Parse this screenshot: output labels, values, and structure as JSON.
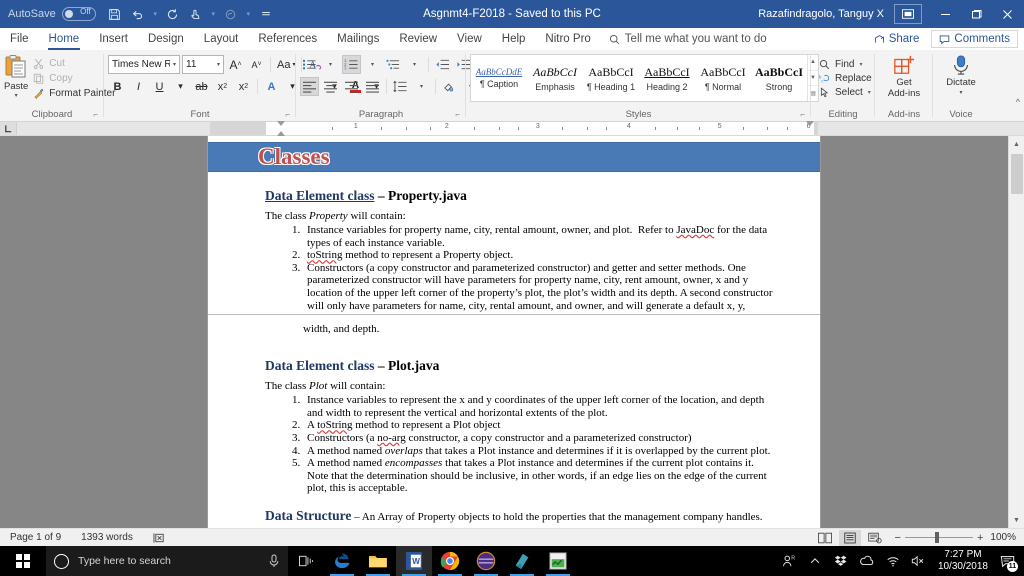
{
  "titlebar": {
    "autosave_label": "AutoSave",
    "autosave_state": "Off",
    "document_title": "Asgnmt4-F2018  -  Saved to this PC",
    "account_name": "Razafindragolo, Tanguy X",
    "qat": [
      {
        "name": "save-icon",
        "glyph": "💾"
      },
      {
        "name": "undo-icon",
        "glyph": "↶"
      },
      {
        "name": "redo-icon",
        "glyph": "↻"
      },
      {
        "name": "touch-mode-icon",
        "glyph": "☝"
      },
      {
        "name": "customize-qat-icon",
        "glyph": "☰"
      }
    ],
    "window_controls": {
      "ribbon_display": "⊟",
      "minimize": "─",
      "restore": "❐",
      "close": "✕"
    }
  },
  "tabs": [
    {
      "label": "File",
      "active": false
    },
    {
      "label": "Home",
      "active": true
    },
    {
      "label": "Insert",
      "active": false
    },
    {
      "label": "Design",
      "active": false
    },
    {
      "label": "Layout",
      "active": false
    },
    {
      "label": "References",
      "active": false
    },
    {
      "label": "Mailings",
      "active": false
    },
    {
      "label": "Review",
      "active": false
    },
    {
      "label": "View",
      "active": false
    },
    {
      "label": "Help",
      "active": false
    },
    {
      "label": "Nitro Pro",
      "active": false
    }
  ],
  "tellme": {
    "placeholder": "Tell me what you want to do"
  },
  "share": {
    "label": "Share"
  },
  "comments": {
    "label": "Comments"
  },
  "ribbon": {
    "clipboard": {
      "group_label": "Clipboard",
      "paste_label": "Paste",
      "cut_label": "Cut",
      "copy_label": "Copy",
      "format_painter_label": "Format Painter"
    },
    "font": {
      "group_label": "Font",
      "font_name": "Times New Ro",
      "font_size": "11",
      "grow_label": "A",
      "shrink_label": "A",
      "change_case_label": "Aa",
      "clear_format_label": "A",
      "bold_label": "B",
      "italic_label": "I",
      "underline_label": "U",
      "strike_label": "ab",
      "subscript_label": "x",
      "superscript_label": "x",
      "text_effects_label": "A",
      "highlight_label": "✎",
      "font_color_label": "A"
    },
    "paragraph": {
      "group_label": "Paragraph"
    },
    "styles": {
      "group_label": "Styles",
      "items": [
        {
          "preview": "AaBbCcDdE",
          "name": "¶ Caption"
        },
        {
          "preview": "AaBbCcI",
          "name": "Emphasis"
        },
        {
          "preview": "AaBbCcI",
          "name": "¶ Heading 1"
        },
        {
          "preview": "AaBbCcI",
          "name": "Heading 2"
        },
        {
          "preview": "AaBbCcI",
          "name": "¶ Normal"
        },
        {
          "preview": "AaBbCcI",
          "name": "Strong"
        }
      ]
    },
    "editing": {
      "group_label": "Editing",
      "find_label": "Find",
      "replace_label": "Replace",
      "select_label": "Select"
    },
    "addins": {
      "group_label": "Add-ins",
      "get_addins_label": "Get\nAdd-ins"
    },
    "voice": {
      "group_label": "Voice",
      "dictate_label": "Dictate"
    }
  },
  "ruler": {
    "ticks": [
      "1",
      "2",
      "3",
      "4",
      "5",
      "6"
    ]
  },
  "document": {
    "banner_title": "Classes",
    "sections": [
      {
        "heading_underlined": "Data Element class",
        "heading_dash": " – ",
        "heading_file": "Property.java",
        "intro_pre": "The class ",
        "intro_em": "Property",
        "intro_post": " will contain:",
        "items": [
          "Instance variables for property name, city, rental amount, owner, and plot.  Refer to JavaDoc for the data types of each instance variable.",
          "toString method to represent a Property object.",
          "Constructors (a copy constructor and parameterized constructor) and getter and setter methods. One parameterized constructor will have parameters for property name, city, rent amount, owner, x and y location of the upper left corner of the property’s plot, the plot’s width and its depth. A second constructor will only have parameters for name, city, rental amount, and owner, and will generate a default x, y,"
        ],
        "after_break": "width, and depth."
      },
      {
        "heading_underlined": "Data Element class",
        "heading_dash": " – ",
        "heading_file": "Plot.java",
        "intro_pre": "The class ",
        "intro_em": "Plot",
        "intro_post": " will contain:",
        "items": [
          "Instance variables to represent the x and y coordinates of the upper left corner of the location, and depth and width to represent the vertical and horizontal extents of the plot.",
          "A toString method to represent a Plot object",
          "Constructors (a no-arg constructor, a copy constructor and a parameterized constructor)",
          "A method named overlaps that takes a Plot instance and determines if it is overlapped by the current plot.",
          "A method named encompasses that takes a Plot instance and determines if the current plot contains it. Note that the determination should be inclusive, in other words, if an edge lies on the edge of the current plot, this is acceptable."
        ]
      }
    ],
    "data_structure": {
      "label": "Data Structure",
      "text": " – An Array of Property objects to hold the properties that the management company handles."
    }
  },
  "statusbar": {
    "page_label": "Page 1 of 9",
    "words_label": "1393 words",
    "proofing_icon": "⌨",
    "zoom_level": "100%",
    "zoom_out": "−",
    "zoom_in": "+"
  },
  "taskbar": {
    "search_placeholder": "Type here to search",
    "apps": [
      {
        "name": "taskbar-edge",
        "active": true
      },
      {
        "name": "taskbar-file-explorer",
        "active": true
      },
      {
        "name": "taskbar-word",
        "active": true
      },
      {
        "name": "taskbar-chrome",
        "active": true
      },
      {
        "name": "taskbar-app-purple",
        "active": true
      },
      {
        "name": "taskbar-app-teal",
        "active": true
      },
      {
        "name": "taskbar-app-green",
        "active": true
      }
    ],
    "clock_time": "7:27 PM",
    "clock_date": "10/30/2018",
    "notification_count": "11"
  },
  "colors": {
    "word_blue": "#2b579a",
    "banner_blue": "#4a7ab5",
    "heading_navy": "#1f3864",
    "title_red": "#c0504d",
    "accent": "#3da0e8"
  }
}
